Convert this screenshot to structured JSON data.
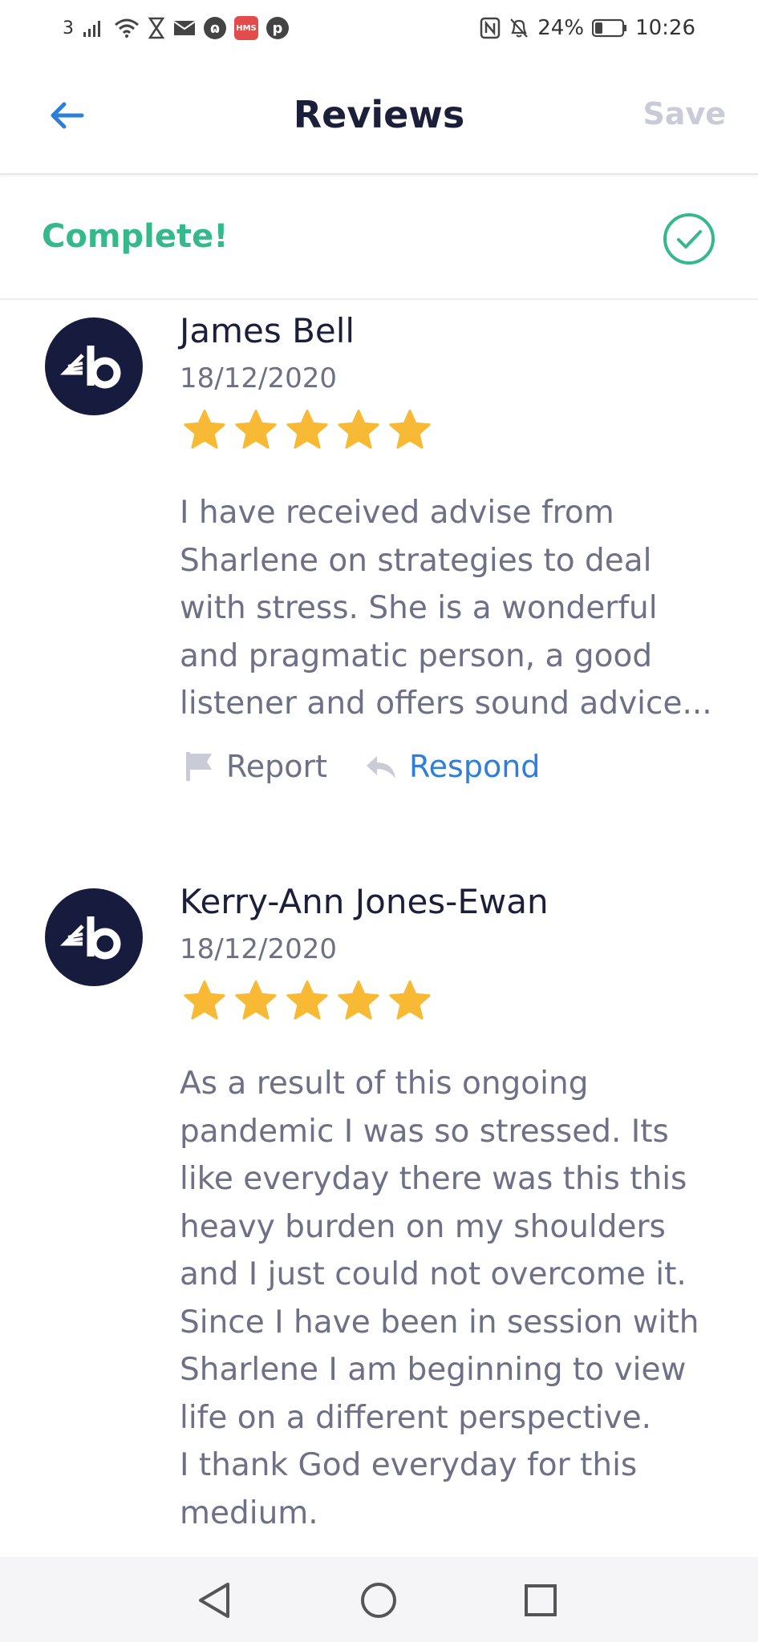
{
  "status_bar": {
    "carrier": "3",
    "battery": "24%",
    "time": "10:26",
    "hms_label": "HMS",
    "icons": [
      "signal-icon",
      "wifi-icon",
      "hourglass-icon",
      "mail-icon",
      "app-icon",
      "hms-icon",
      "pinterest-icon",
      "nfc-icon",
      "bell-off-icon",
      "battery-icon"
    ]
  },
  "header": {
    "title": "Reviews",
    "save_label": "Save",
    "back_icon": "arrow-left-icon"
  },
  "status_row": {
    "label": "Complete!",
    "icon": "check-circle-icon"
  },
  "colors": {
    "accent_green": "#35b98a",
    "accent_blue": "#2f7ed8",
    "star_yellow": "#f8b935",
    "avatar_navy": "#171c3f",
    "title_dark": "#1c1f3a"
  },
  "reviews": [
    {
      "name": "James Bell",
      "date": "18/12/2020",
      "rating": 5,
      "text": "I have received advise from\nSharlene on strategies to deal\nwith stress.  She is a wonderful\nand pragmatic person, a good\nlistener and offers sound advice...",
      "report_label": "Report",
      "respond_label": "Respond"
    },
    {
      "name": "Kerry-Ann Jones-Ewan",
      "date": "18/12/2020",
      "rating": 5,
      "text": "As a result of this ongoing\npandemic I was so stressed. Its\nlike everyday there was this this\nheavy burden on my shoulders\nand I just could not overcome it.\nSince I have been in session with\nSharlene I am beginning to view\nlife on a different perspective.\nI thank God everyday for this\nmedium."
    }
  ],
  "nav_bar": {
    "icons": [
      "back-triangle-icon",
      "home-circle-icon",
      "recents-square-icon"
    ]
  }
}
